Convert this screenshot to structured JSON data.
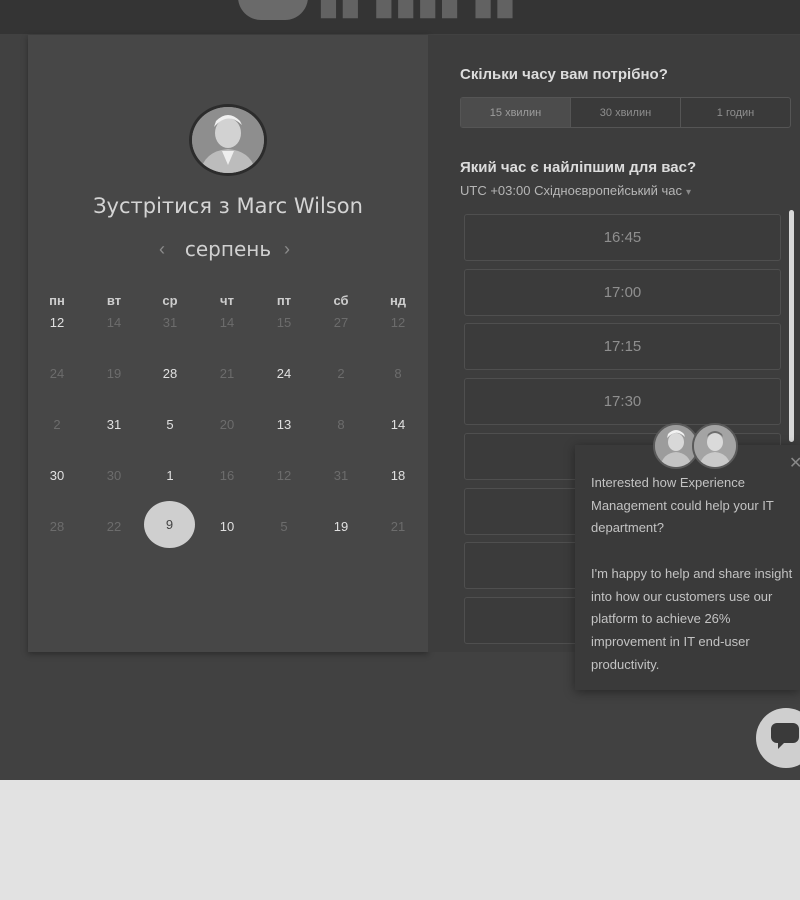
{
  "left": {
    "meet_title": "Зустрітися з Marc Wilson",
    "month": "серпень",
    "prev_arrow": "‹",
    "next_arrow": "›",
    "weekdays": [
      "пн",
      "вт",
      "ср",
      "чт",
      "пт",
      "сб",
      "нд"
    ],
    "weeks": [
      [
        "12",
        "14",
        "31",
        "14",
        "15",
        "27",
        "12"
      ],
      [
        "24",
        "19",
        "28",
        "21",
        "24",
        "2",
        "8"
      ],
      [
        "2",
        "31",
        "5",
        "20",
        "13",
        "8",
        "14"
      ],
      [
        "30",
        "30",
        "1",
        "16",
        "12",
        "31",
        "18"
      ],
      [
        "28",
        "22",
        "9",
        "10",
        "5",
        "19",
        "21"
      ]
    ],
    "selected_day": "9"
  },
  "right": {
    "duration_title": "Скільки часу вам потрібно?",
    "durations": [
      "15 хвилин",
      "30 хвилин",
      "1 годин"
    ],
    "time_title": "Який час є найліпшим для вас?",
    "timezone": "UTC +03:00 Східноєвропейський час",
    "timezone_caret": "▾",
    "slots": [
      "16:45",
      "17:00",
      "17:15",
      "17:30",
      "",
      "",
      "",
      ""
    ]
  },
  "popup": {
    "close": "✕",
    "paragraph1": "Interested how Experience Management could help your IT department?",
    "paragraph2": "I'm happy to help and share insight into how our customers use our platform to achieve 26% improvement in IT end-user productivity."
  },
  "icons": {
    "chat": "chat-bubble-icon",
    "avatar": "person-avatar",
    "logo": "speech-bubble-logo"
  },
  "colors": {
    "overlay_bg": "#414141",
    "selected_day_bg": "#cfcfcf",
    "page_bg": "#e2e2e2"
  }
}
